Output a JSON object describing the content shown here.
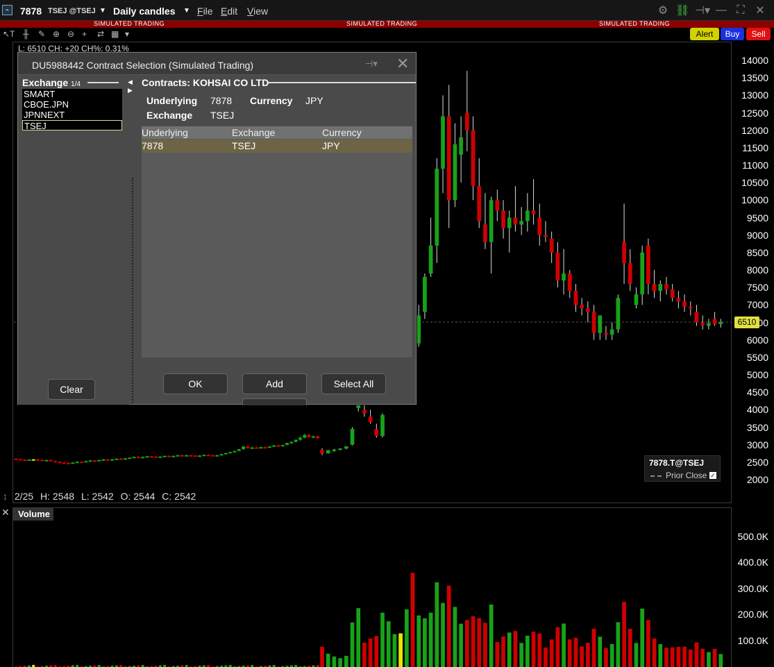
{
  "titlebar": {
    "symbol": "7878",
    "exchange_label": "TSEJ @TSEJ",
    "period": "Daily candles",
    "menus": [
      "File",
      "Edit",
      "View"
    ]
  },
  "sim_banner": "SIMULATED TRADING",
  "order_buttons": {
    "alert": "Alert",
    "buy": "Buy",
    "sell": "Sell"
  },
  "chart": {
    "legend_top": "L: 6510 CH: +20 CH%: 0.31%",
    "hover": {
      "date": "2/25",
      "h": "H: 2548",
      "l": "L: 2542",
      "o": "O: 2544",
      "c": "C: 2542"
    },
    "last_price": "6510",
    "price_legend": {
      "symbol": "7878.T@TSEJ",
      "prior_close": "Prior Close"
    },
    "volume_tab": "Volume"
  },
  "chart_data": [
    {
      "type": "candlestick",
      "title": "",
      "ylim": [
        1600,
        14300
      ],
      "yticks": [
        2000,
        2500,
        3000,
        3500,
        4000,
        4500,
        5000,
        5500,
        6000,
        6500,
        7000,
        7500,
        8000,
        8500,
        9000,
        9500,
        10000,
        10500,
        11000,
        11500,
        12000,
        12500,
        13000,
        13500,
        14000
      ],
      "last": 6510,
      "candles_ohlc": [
        [
          2600,
          2620,
          2580,
          2590
        ],
        [
          2590,
          2600,
          2560,
          2570
        ],
        [
          2570,
          2590,
          2550,
          2560
        ],
        [
          2560,
          2580,
          2540,
          2575
        ],
        [
          2575,
          2590,
          2560,
          2580
        ],
        [
          2580,
          2600,
          2560,
          2570
        ],
        [
          2570,
          2580,
          2540,
          2550
        ],
        [
          2550,
          2570,
          2530,
          2560
        ],
        [
          2560,
          2580,
          2520,
          2530
        ],
        [
          2530,
          2550,
          2500,
          2510
        ],
        [
          2510,
          2530,
          2480,
          2490
        ],
        [
          2490,
          2510,
          2470,
          2480
        ],
        [
          2480,
          2500,
          2460,
          2470
        ],
        [
          2470,
          2500,
          2460,
          2490
        ],
        [
          2490,
          2520,
          2480,
          2510
        ],
        [
          2510,
          2530,
          2490,
          2500
        ],
        [
          2500,
          2540,
          2490,
          2530
        ],
        [
          2530,
          2560,
          2520,
          2550
        ],
        [
          2550,
          2570,
          2530,
          2540
        ],
        [
          2540,
          2570,
          2530,
          2560
        ],
        [
          2560,
          2590,
          2550,
          2580
        ],
        [
          2580,
          2600,
          2560,
          2570
        ],
        [
          2570,
          2590,
          2550,
          2580
        ],
        [
          2580,
          2610,
          2570,
          2600
        ],
        [
          2600,
          2620,
          2580,
          2590
        ],
        [
          2590,
          2620,
          2580,
          2610
        ],
        [
          2610,
          2640,
          2600,
          2630
        ],
        [
          2630,
          2660,
          2620,
          2650
        ],
        [
          2650,
          2670,
          2630,
          2640
        ],
        [
          2640,
          2660,
          2620,
          2650
        ],
        [
          2650,
          2680,
          2640,
          2670
        ],
        [
          2670,
          2690,
          2650,
          2660
        ],
        [
          2660,
          2680,
          2640,
          2650
        ],
        [
          2650,
          2670,
          2630,
          2660
        ],
        [
          2660,
          2690,
          2650,
          2680
        ],
        [
          2680,
          2700,
          2660,
          2670
        ],
        [
          2670,
          2690,
          2650,
          2680
        ],
        [
          2680,
          2710,
          2670,
          2700
        ],
        [
          2700,
          2720,
          2680,
          2690
        ],
        [
          2690,
          2710,
          2670,
          2700
        ],
        [
          2700,
          2720,
          2680,
          2690
        ],
        [
          2690,
          2710,
          2670,
          2680
        ],
        [
          2680,
          2700,
          2660,
          2690
        ],
        [
          2690,
          2720,
          2680,
          2710
        ],
        [
          2710,
          2730,
          2690,
          2700
        ],
        [
          2700,
          2720,
          2680,
          2690
        ],
        [
          2690,
          2710,
          2670,
          2700
        ],
        [
          2700,
          2740,
          2690,
          2730
        ],
        [
          2730,
          2770,
          2720,
          2760
        ],
        [
          2760,
          2800,
          2750,
          2790
        ],
        [
          2790,
          2830,
          2780,
          2820
        ],
        [
          2820,
          2880,
          2810,
          2870
        ],
        [
          2870,
          2960,
          2850,
          2950
        ],
        [
          2950,
          2980,
          2880,
          2900
        ],
        [
          2900,
          2940,
          2880,
          2920
        ],
        [
          2920,
          2950,
          2890,
          2910
        ],
        [
          2910,
          2940,
          2890,
          2930
        ],
        [
          2930,
          2960,
          2900,
          2920
        ],
        [
          2920,
          2960,
          2910,
          2950
        ],
        [
          2950,
          2990,
          2930,
          2980
        ],
        [
          2980,
          3010,
          2950,
          2970
        ],
        [
          2970,
          3000,
          2950,
          2990
        ],
        [
          2990,
          3060,
          2980,
          3050
        ],
        [
          3050,
          3100,
          3020,
          3080
        ],
        [
          3080,
          3150,
          3060,
          3140
        ],
        [
          3140,
          3250,
          3100,
          3200
        ],
        [
          3200,
          3320,
          3180,
          3280
        ],
        [
          3280,
          3320,
          3200,
          3220
        ],
        [
          3220,
          3260,
          3180,
          3240
        ],
        [
          3240,
          3260,
          3160,
          3180
        ],
        [
          2850,
          2900,
          2700,
          2750
        ],
        [
          2750,
          2850,
          2740,
          2840
        ],
        [
          2840,
          2880,
          2800,
          2860
        ],
        [
          2860,
          2900,
          2840,
          2890
        ],
        [
          2890,
          2960,
          2870,
          2950
        ],
        [
          3000,
          3500,
          2980,
          3450
        ],
        [
          4050,
          4900,
          3950,
          4850
        ],
        [
          4000,
          4150,
          3800,
          3900
        ],
        [
          3800,
          4000,
          3600,
          3650
        ],
        [
          3450,
          3600,
          3200,
          3250
        ],
        [
          3250,
          3900,
          3200,
          3850
        ],
        [
          4200,
          4900,
          4150,
          4850
        ],
        [
          4850,
          5400,
          4800,
          5300
        ],
        [
          6300,
          6700,
          5900,
          6300
        ],
        [
          6100,
          7400,
          6000,
          7100
        ],
        [
          8300,
          8900,
          5700,
          5800
        ],
        [
          5900,
          7000,
          5800,
          6700
        ],
        [
          6800,
          7900,
          6600,
          7800
        ],
        [
          7900,
          9500,
          7800,
          8700
        ],
        [
          8700,
          11200,
          8200,
          10900
        ],
        [
          10900,
          13000,
          10200,
          12400
        ],
        [
          12400,
          13300,
          9200,
          10000
        ],
        [
          10000,
          12200,
          9800,
          11600
        ],
        [
          11300,
          12400,
          10500,
          11800
        ],
        [
          12500,
          13700,
          11400,
          12000
        ],
        [
          12000,
          12400,
          10000,
          10400
        ],
        [
          10400,
          11200,
          9200,
          9400
        ],
        [
          9300,
          10200,
          8600,
          8800
        ],
        [
          8800,
          10100,
          7900,
          10000
        ],
        [
          10000,
          10300,
          9400,
          9700
        ],
        [
          9700,
          10000,
          8900,
          9200
        ],
        [
          9200,
          9700,
          8500,
          9500
        ],
        [
          9500,
          10400,
          9100,
          9300
        ],
        [
          9300,
          9800,
          9000,
          9400
        ],
        [
          9400,
          10200,
          9100,
          9700
        ],
        [
          9700,
          10600,
          9300,
          9600
        ],
        [
          9500,
          9900,
          8700,
          9000
        ],
        [
          9000,
          9400,
          8800,
          8950
        ],
        [
          8900,
          9100,
          8200,
          8500
        ],
        [
          8500,
          8800,
          7500,
          7700
        ],
        [
          7700,
          8600,
          7300,
          7900
        ],
        [
          7900,
          8000,
          7200,
          7400
        ],
        [
          7400,
          7600,
          6800,
          7000
        ],
        [
          7000,
          7200,
          6700,
          6900
        ],
        [
          6900,
          7100,
          6500,
          6800
        ],
        [
          6800,
          7000,
          6000,
          6200
        ],
        [
          6200,
          6700,
          6000,
          6700
        ],
        [
          6200,
          6400,
          6000,
          6150
        ],
        [
          6150,
          6500,
          6000,
          6300
        ],
        [
          6300,
          7300,
          6200,
          7200
        ],
        [
          8800,
          9900,
          7600,
          8200
        ],
        [
          8200,
          8600,
          7400,
          7600
        ],
        [
          7000,
          7500,
          6900,
          7300
        ],
        [
          7300,
          8700,
          7000,
          8500
        ],
        [
          8700,
          8900,
          7300,
          7600
        ],
        [
          7600,
          8000,
          7200,
          7400
        ],
        [
          7400,
          7700,
          7100,
          7600
        ],
        [
          7600,
          7800,
          7300,
          7450
        ],
        [
          7450,
          7600,
          7100,
          7200
        ],
        [
          7200,
          7400,
          6900,
          7100
        ],
        [
          7100,
          7300,
          6800,
          6950
        ],
        [
          6950,
          7100,
          6700,
          6900
        ],
        [
          6800,
          7000,
          6400,
          6500
        ],
        [
          6500,
          6700,
          6300,
          6420
        ],
        [
          6400,
          6600,
          6300,
          6480
        ],
        [
          6600,
          6800,
          6400,
          6450
        ],
        [
          6450,
          6600,
          6350,
          6510
        ]
      ]
    },
    {
      "type": "bar",
      "title": "Volume",
      "ylim": [
        0,
        600000
      ],
      "yticks": [
        "100.0K",
        "200.0K",
        "300.0K",
        "400.0K",
        "500.0K"
      ]
    }
  ],
  "dialog": {
    "title": "DU5988442 Contract Selection (Simulated Trading)",
    "exchange_header": "Exchange",
    "exchange_count": "1/4",
    "exchanges": [
      "SMART",
      "CBOE.JPN",
      "JPNNEXT",
      "TSEJ"
    ],
    "contracts_header": "Contracts: KOHSAI CO LTD",
    "underlying_label": "Underlying",
    "underlying_value": "7878",
    "currency_label": "Currency",
    "currency_value": "JPY",
    "exchange_label": "Exchange",
    "exchange_value": "TSEJ",
    "columns": [
      "Underlying",
      "Exchange",
      "Currency"
    ],
    "rows": [
      [
        "7878",
        "TSEJ",
        "JPY"
      ]
    ],
    "buttons": {
      "clear": "Clear",
      "ok": "OK",
      "add": "Add",
      "select_all": "Select All"
    }
  }
}
